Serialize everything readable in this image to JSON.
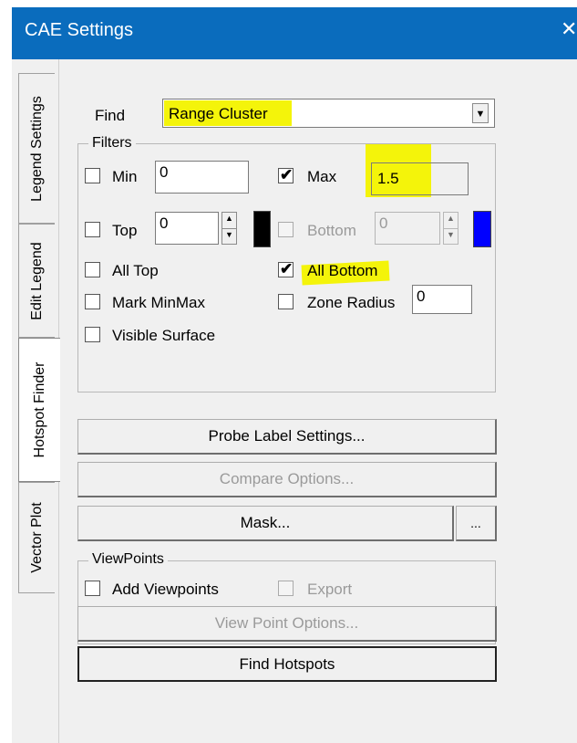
{
  "window": {
    "title": "CAE Settings",
    "close_glyph": "✕"
  },
  "tabs": [
    {
      "label": "Legend Settings"
    },
    {
      "label": "Edit Legend"
    },
    {
      "label": "Hotspot Finder"
    },
    {
      "label": "Vector Plot"
    }
  ],
  "find": {
    "label": "Find",
    "value": "Range Cluster",
    "dropdown_glyph": "▼"
  },
  "filters": {
    "group_label": "Filters",
    "min": {
      "label": "Min",
      "checked": false,
      "value": "0"
    },
    "max": {
      "label": "Max",
      "checked": true,
      "value": "1.5"
    },
    "top": {
      "label": "Top",
      "checked": false,
      "value": "0",
      "color": "#000000"
    },
    "bottom": {
      "label": "Bottom",
      "checked": false,
      "value": "0",
      "color": "#0000ff",
      "disabled": true
    },
    "all_top": {
      "label": "All Top",
      "checked": false
    },
    "all_bottom": {
      "label": "All Bottom",
      "checked": true
    },
    "mark_minmax": {
      "label": "Mark MinMax",
      "checked": false
    },
    "zone_radius": {
      "label": "Zone Radius",
      "checked": false,
      "value": "0"
    },
    "visible_surface": {
      "label": "Visible Surface",
      "checked": false
    }
  },
  "buttons": {
    "probe_label": "Probe Label Settings...",
    "compare_options": "Compare Options...",
    "mask": "Mask...",
    "mask_more": "...",
    "view_point_options": "View Point Options...",
    "find_hotspots": "Find Hotspots"
  },
  "viewpoints": {
    "group_label": "ViewPoints",
    "add": {
      "label": "Add Viewpoints",
      "checked": false
    },
    "export": {
      "label": "Export",
      "checked": false,
      "disabled": true
    }
  },
  "colors": {
    "titlebar": "#0a6cbd",
    "highlight": "#f4f40a"
  },
  "icons": {
    "check": "✔",
    "spin_up": "▲",
    "spin_down": "▼"
  }
}
